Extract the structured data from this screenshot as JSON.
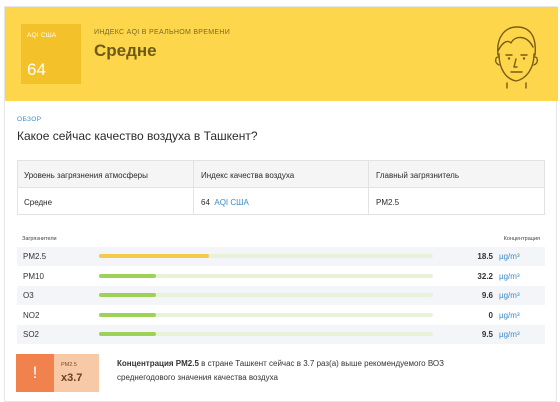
{
  "header": {
    "aqi_label": "AQI США",
    "aqi_value": "64",
    "subtitle": "ИНДЕКС AQI В РЕАЛЬНОМ ВРЕМЕНИ",
    "status": "Средне",
    "bg_color": "#fdd64b",
    "icon": "face-neutral-icon"
  },
  "overview": {
    "tag": "ОБЗОР",
    "question": "Какое сейчас качество воздуха в Ташкент?"
  },
  "summary": {
    "headers": [
      "Уровень загрязнения атмосферы",
      "Индекс качества воздуха",
      "Главный загрязнитель"
    ],
    "level": "Средне",
    "index_value": "64",
    "index_unit": "AQI США",
    "main_pollutant": "PM2.5"
  },
  "pollutants": {
    "col_left": "Загрязнители",
    "col_right": "Концентрация",
    "unit": "µg/m³",
    "rows": [
      {
        "name": "PM2.5",
        "value": "18.5",
        "level": 0.33,
        "color": "#f5c94a"
      },
      {
        "name": "PM10",
        "value": "32.2",
        "level": 0.17,
        "color": "#9ed157"
      },
      {
        "name": "O3",
        "value": "9.6",
        "level": 0.17,
        "color": "#9ed157"
      },
      {
        "name": "NO2",
        "value": "0",
        "level": 0.17,
        "color": "#9ed157"
      },
      {
        "name": "SO2",
        "value": "9.5",
        "level": 0.17,
        "color": "#9ed157"
      }
    ]
  },
  "alert": {
    "icon_text": "!",
    "pollutant": "PM2.5",
    "multiplier": "x3.7",
    "text_bold": "Концентрация PM2.5",
    "text_rest": " в стране Ташкент сейчас в 3.7 раз(а) выше рекомендуемого ВОЗ среднегодового значения качества воздуха"
  }
}
